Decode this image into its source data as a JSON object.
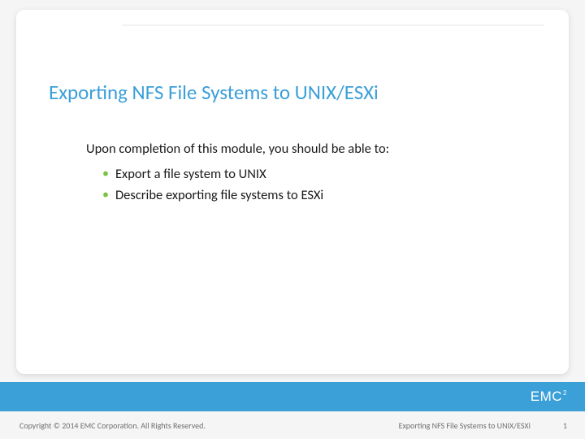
{
  "slide": {
    "title": "Exporting NFS File Systems to UNIX/ESXi",
    "lead": "Upon completion of this module, you should be able to:",
    "bullets": [
      "Export a file system to UNIX",
      "Describe exporting file systems to ESXi"
    ]
  },
  "branding": {
    "logo_text": "EMC",
    "logo_sup": "2"
  },
  "footer": {
    "copyright": "Copyright © 2014 EMC Corporation. All Rights Reserved.",
    "breadcrumb": "Exporting NFS File Systems to UNIX/ESXi",
    "page_number": "1"
  }
}
